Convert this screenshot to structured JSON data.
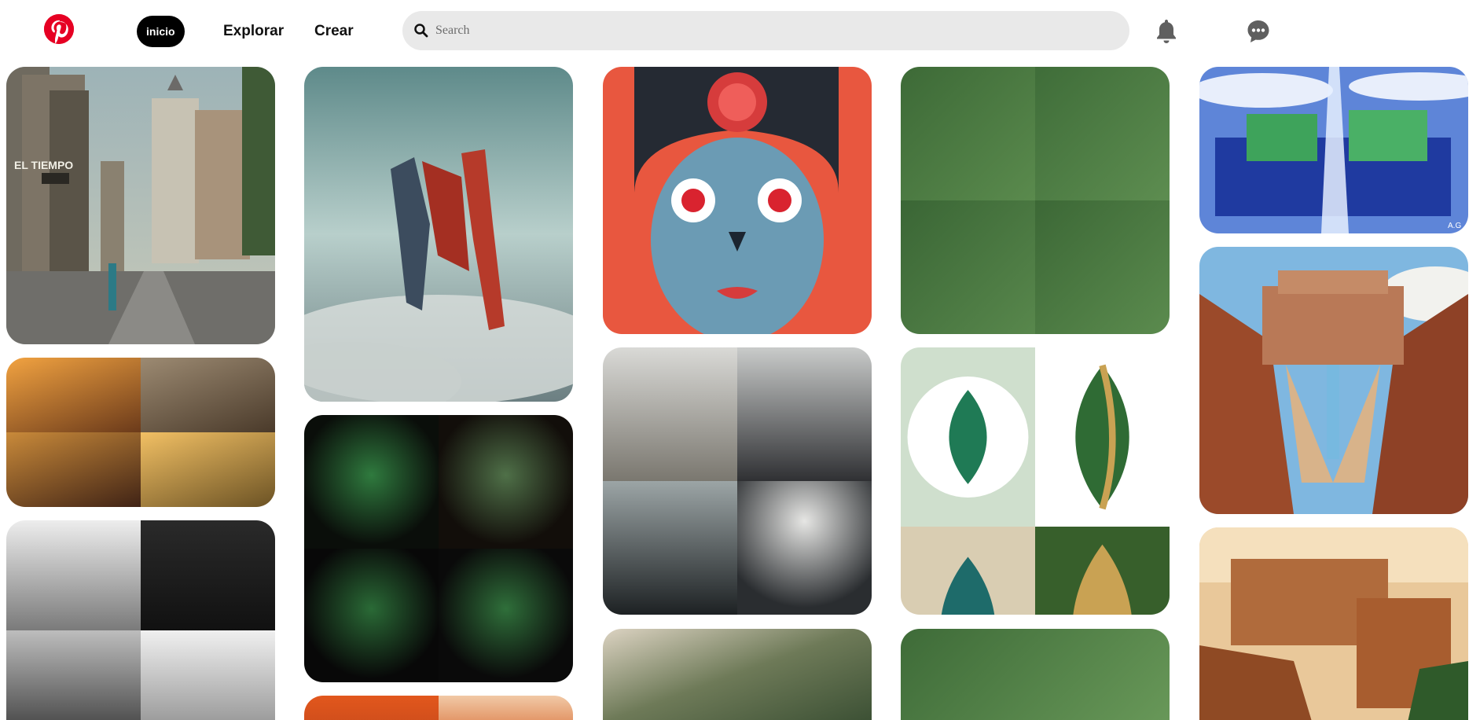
{
  "header": {
    "logo_icon": "pinterest-logo",
    "home_label": "inicio",
    "explore_label": "Explorar",
    "create_label": "Crear",
    "search_placeholder": "Search",
    "notifications_icon": "bell-icon",
    "messages_icon": "chat-bubble-icon"
  },
  "colors": {
    "brand": "#e60023",
    "search_bg": "#e9e9e9",
    "active_pill": "#000000"
  },
  "pins": {
    "col1": [
      {
        "description": "city street with church and El Tiempo building",
        "overlay_text": "EL TIEMPO"
      },
      {
        "description": "bulldog and man portraits at sunset (4-panel)"
      },
      {
        "description": "manga men in suits, black and white (4-panel)"
      }
    ],
    "col2": [
      {
        "description": "flying superheroes above clouds"
      },
      {
        "description": "men in green blazers at desk (4-panel)"
      },
      {
        "description": "red-haired illustrations (partial)"
      }
    ],
    "col3": [
      {
        "description": "robot helmet girl illustration"
      },
      {
        "description": "dark fashion sculptures (4-panel)"
      },
      {
        "description": "aerial park landscape (partial)"
      }
    ],
    "col4": [
      {
        "description": "green leaf business cards (4-panel)"
      },
      {
        "description": "green leaf logos (4-panel)"
      },
      {
        "description": "green leaf card closeup (partial)"
      }
    ],
    "col5": [
      {
        "description": "futuristic blue city illustration",
        "overlay_text": "A.G"
      },
      {
        "description": "palace on canyon cliff with waterfall"
      },
      {
        "description": "desert canyon palace (partial)"
      }
    ]
  }
}
